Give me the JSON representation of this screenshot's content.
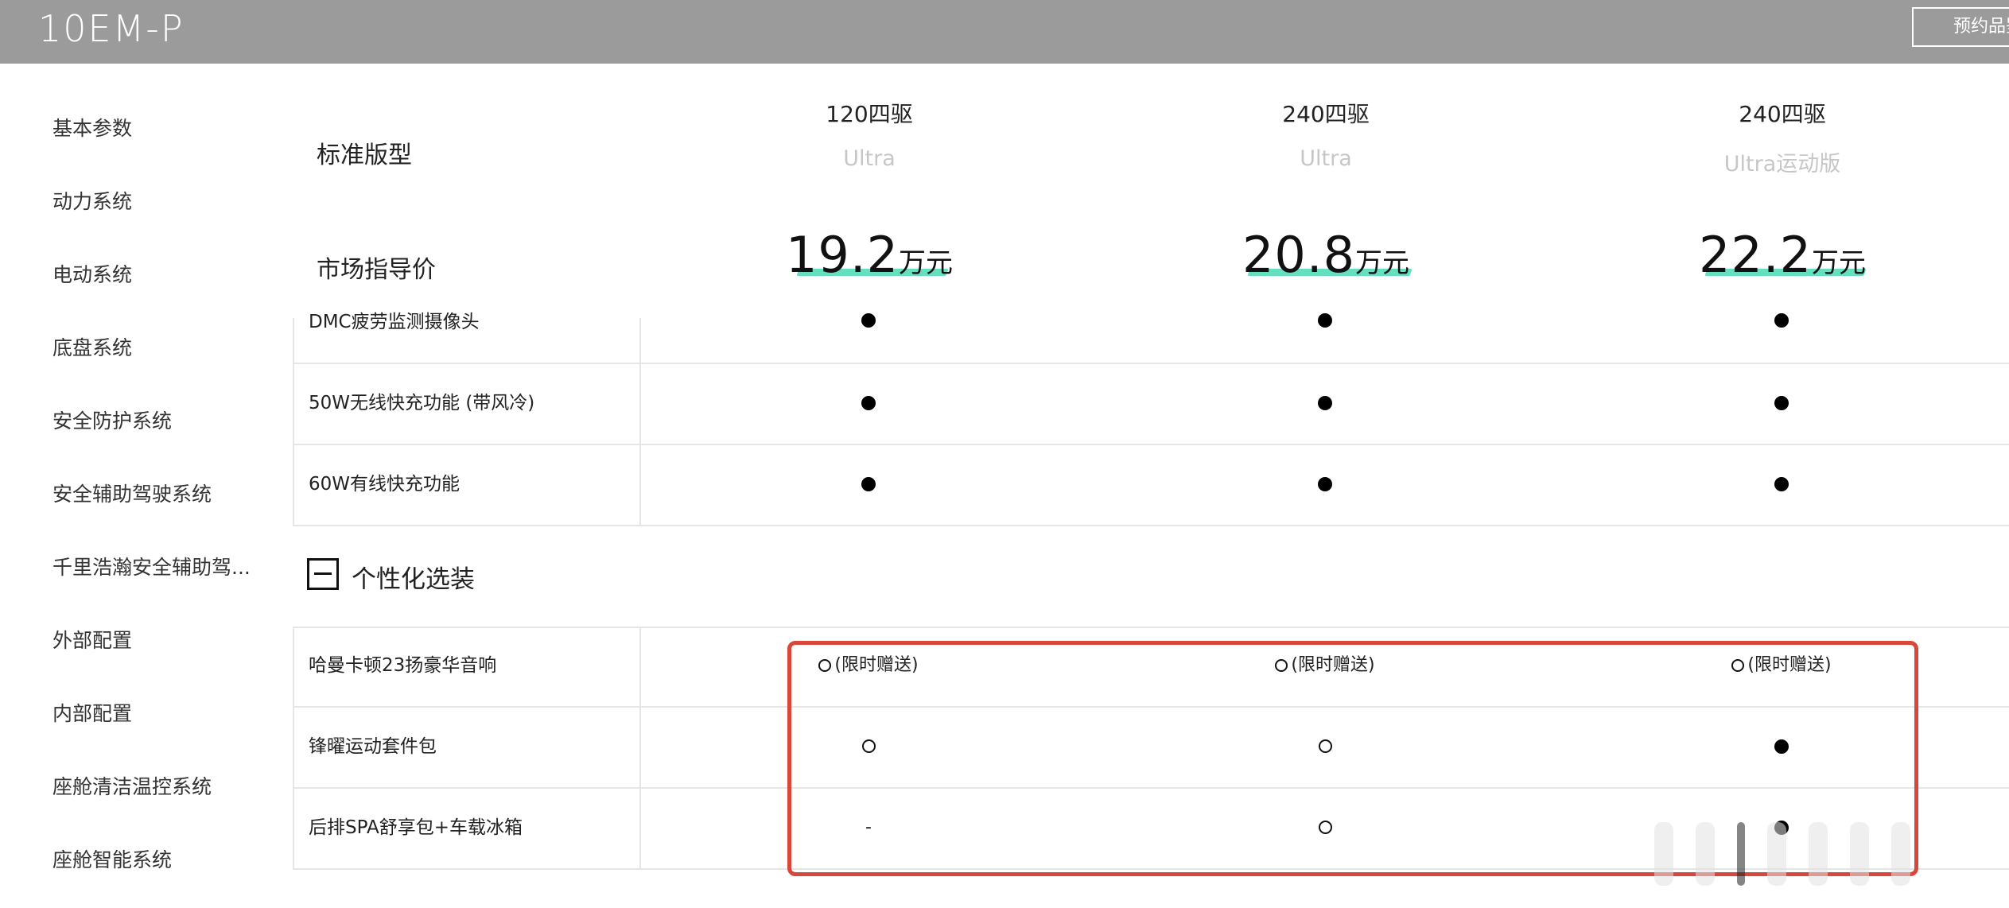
{
  "brand": {
    "logo_text": "10EM-P",
    "reserve_label": "预约品鉴"
  },
  "sidebar": {
    "items": [
      {
        "label": "基本参数"
      },
      {
        "label": "动力系统"
      },
      {
        "label": "电动系统"
      },
      {
        "label": "底盘系统"
      },
      {
        "label": "安全防护系统"
      },
      {
        "label": "安全辅助驾驶系统"
      },
      {
        "label": "千里浩瀚安全辅助驾..."
      },
      {
        "label": "外部配置"
      },
      {
        "label": "内部配置"
      },
      {
        "label": "座舱清洁温控系统"
      },
      {
        "label": "座舱智能系统"
      }
    ]
  },
  "header": {
    "model_label": "标准版型",
    "price_label": "市场指导价",
    "columns": [
      {
        "name": "120四驱",
        "trim": "Ultra",
        "price": "19.2",
        "unit": "万元"
      },
      {
        "name": "240四驱",
        "trim": "Ultra",
        "price": "20.8",
        "unit": "万元"
      },
      {
        "name": "240四驱",
        "trim": "Ultra运动版",
        "price": "22.2",
        "unit": "万元"
      }
    ]
  },
  "table": {
    "rows_top": [
      {
        "label": "DMC疲劳监测摄像头",
        "cells": [
          "standard",
          "standard",
          "standard"
        ]
      },
      {
        "label": "50W无线快充功能 (带风冷)",
        "cells": [
          "standard",
          "standard",
          "standard"
        ]
      },
      {
        "label": "60W有线快充功能",
        "cells": [
          "standard",
          "standard",
          "standard"
        ]
      }
    ],
    "section": {
      "title": "个性化选装",
      "toggle": "collapse"
    },
    "rows_bottom": [
      {
        "label": "哈曼卡顿23扬豪华音响",
        "cells": [
          "gift",
          "gift",
          "gift"
        ]
      },
      {
        "label": "锋曜运动套件包",
        "cells": [
          "optional",
          "optional",
          "standard"
        ]
      },
      {
        "label": "后排SPA舒享包+车载冰箱",
        "cells": [
          "none",
          "optional",
          "standard"
        ]
      }
    ],
    "gift_text": "(限时赠送)",
    "none_text": "-"
  },
  "colors": {
    "topbar": "#9b9b9b",
    "price_underline": "#64e0c0",
    "highlight": "#d8473b"
  }
}
